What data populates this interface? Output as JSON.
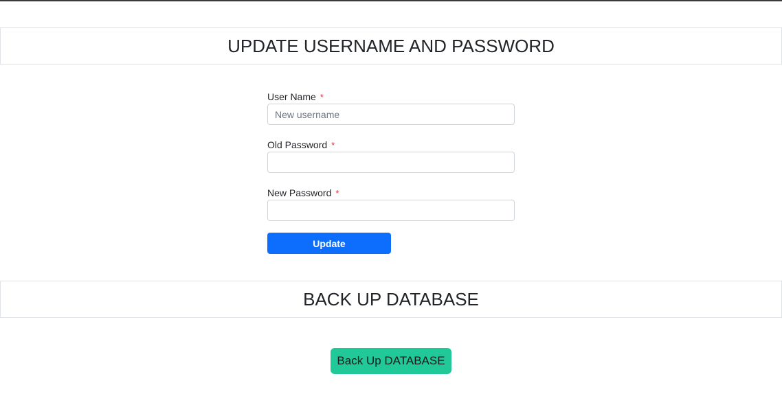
{
  "update_section": {
    "title": "UPDATE USERNAME AND PASSWORD",
    "fields": [
      {
        "label": "User Name",
        "required_mark": "*",
        "placeholder": "New username",
        "value": ""
      },
      {
        "label": "Old Password",
        "required_mark": "*",
        "placeholder": "",
        "value": ""
      },
      {
        "label": "New Password",
        "required_mark": "*",
        "placeholder": "",
        "value": ""
      }
    ],
    "submit_label": "Update"
  },
  "backup_section": {
    "title": "BACK UP DATABASE",
    "button_label": "Back Up DATABASE"
  },
  "colors": {
    "primary_button": "#0d6efd",
    "backup_button": "#20c997",
    "required_star": "#dc3545",
    "border": "#dee2e6"
  }
}
